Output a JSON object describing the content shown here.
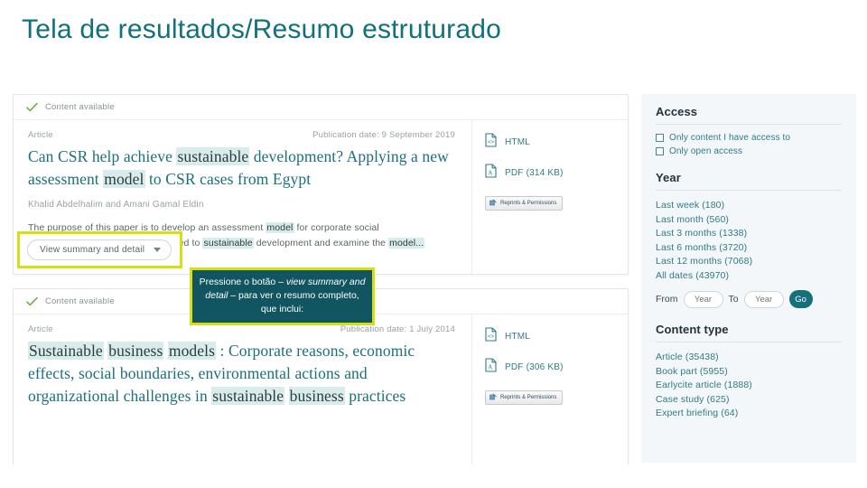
{
  "slide": {
    "title": "Tela de resultados/Resumo estruturado",
    "title_color": "#11707c"
  },
  "callout": {
    "line1_pre": "Pressione o botão – ",
    "line1_em": "view",
    "line2_em": "summary and detail",
    "line2_post": " – para ver",
    "line3": "o resumo completo, que inclui:",
    "bg_color": "#10555f",
    "border_color": "#d7df12"
  },
  "results": [
    {
      "status": "Content available",
      "type": "Article",
      "date_label": "Publication date: 9 September 2019",
      "title_parts": [
        {
          "t": "Can CSR help achieve ",
          "hl": false
        },
        {
          "t": "sustainable",
          "hl": true
        },
        {
          "t": " development? Applying a new assessment ",
          "hl": false
        },
        {
          "t": "model",
          "hl": true
        },
        {
          "t": " to CSR cases from Egypt",
          "hl": false
        }
      ],
      "authors": "Khalid Abdelhalim and Amani Gamal Eldin",
      "abstract_parts": [
        {
          "t": "The purpose of this paper is to develop an assessment ",
          "hl": false
        },
        {
          "t": "model",
          "hl": true
        },
        {
          "t": " for corporate social responsibility (CSR) that is interlinked to ",
          "hl": false
        },
        {
          "t": "sustainable",
          "hl": true
        },
        {
          "t": " development and examine the ",
          "hl": false
        },
        {
          "t": "model...",
          "hl": true
        }
      ],
      "summary_button": "View summary and detail",
      "has_summary_button": true,
      "links": [
        {
          "icon": "html-file-icon",
          "label": "HTML"
        },
        {
          "icon": "pdf-file-icon",
          "label": "PDF (314 KB)"
        }
      ],
      "reprints_label": "Reprints & Permissions"
    },
    {
      "status": "Content available",
      "type": "Article",
      "date_label": "Publication date: 1 July 2014",
      "title_parts": [
        {
          "t": "Sustainable",
          "hl": true
        },
        {
          "t": " ",
          "hl": false
        },
        {
          "t": "business",
          "hl": true
        },
        {
          "t": " ",
          "hl": false
        },
        {
          "t": "models",
          "hl": true
        },
        {
          "t": " : Corporate reasons, economic effects, social boundaries, environmental actions and organizational challenges in ",
          "hl": false
        },
        {
          "t": "sustainable",
          "hl": true
        },
        {
          "t": " ",
          "hl": false
        },
        {
          "t": "business",
          "hl": true
        },
        {
          "t": " practices",
          "hl": false
        }
      ],
      "authors": "",
      "abstract_parts": [],
      "summary_button": "",
      "has_summary_button": false,
      "links": [
        {
          "icon": "html-file-icon",
          "label": "HTML"
        },
        {
          "icon": "pdf-file-icon",
          "label": "PDF (306 KB)"
        }
      ],
      "reprints_label": "Reprints & Permissions"
    }
  ],
  "filters": {
    "access": {
      "heading": "Access",
      "options": [
        "Only content I have access to",
        "Only open access"
      ]
    },
    "year": {
      "heading": "Year",
      "options": [
        "Last week (180)",
        "Last month (560)",
        "Last 3 months (1338)",
        "Last 6 months (3720)",
        "Last 12 months (7068)",
        "All dates (43970)"
      ],
      "from_label": "From",
      "to_label": "To",
      "from_placeholder": "Year",
      "to_placeholder": "Year",
      "go_label": "Go",
      "go_color": "#15707c"
    },
    "content_type": {
      "heading": "Content type",
      "options": [
        "Article (35438)",
        "Book part (5955)",
        "Earlycite article (1888)",
        "Case study (625)",
        "Expert briefing (64)"
      ]
    }
  }
}
